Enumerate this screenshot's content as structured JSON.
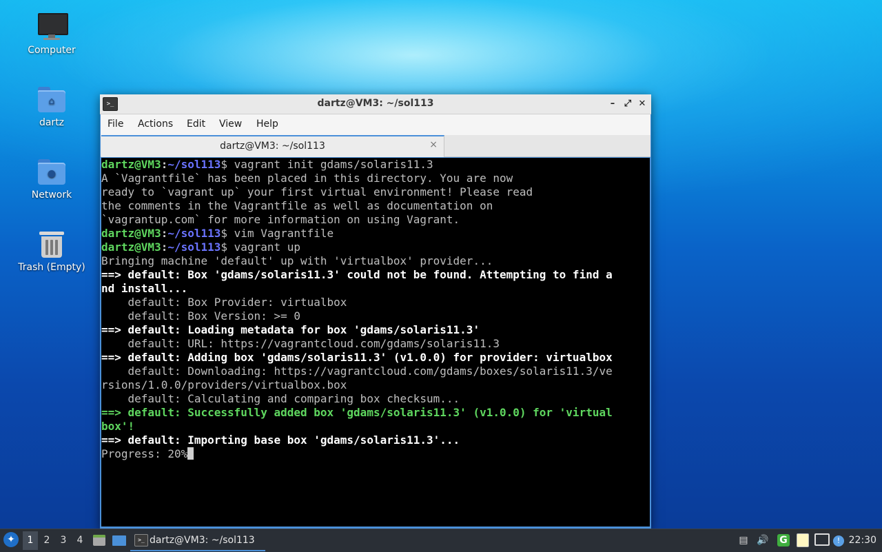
{
  "desktop": {
    "icons": [
      {
        "label": "Computer"
      },
      {
        "label": "dartz"
      },
      {
        "label": "Network"
      },
      {
        "label": "Trash (Empty)"
      }
    ]
  },
  "window": {
    "title": "dartz@VM3: ~/sol113",
    "menu": [
      "File",
      "Actions",
      "Edit",
      "View",
      "Help"
    ],
    "tab_label": "dartz@VM3: ~/sol113",
    "tab_close": "×",
    "controls": {
      "minimize": "–",
      "maximize": "⤢",
      "close": "✕"
    }
  },
  "terminal": {
    "prompt_user": "dartz@VM3",
    "prompt_path": "~/sol113",
    "commands": [
      "vagrant init gdams/solaris11.3",
      "vim Vagrantfile",
      "vagrant up"
    ],
    "output": [
      "A `Vagrantfile` has been placed in this directory. You are now",
      "ready to `vagrant up` your first virtual environment! Please read",
      "the comments in the Vagrantfile as well as documentation on",
      "`vagrantup.com` for more information on using Vagrant.",
      "Bringing machine 'default' up with 'virtualbox' provider...",
      "==> default: Box 'gdams/solaris11.3' could not be found. Attempting to find a",
      "nd install...",
      "    default: Box Provider: virtualbox",
      "    default: Box Version: >= 0",
      "==> default: Loading metadata for box 'gdams/solaris11.3'",
      "    default: URL: https://vagrantcloud.com/gdams/solaris11.3",
      "==> default: Adding box 'gdams/solaris11.3' (v1.0.0) for provider: virtualbox",
      "    default: Downloading: https://vagrantcloud.com/gdams/boxes/solaris11.3/ve",
      "rsions/1.0.0/providers/virtualbox.box",
      "    default: Calculating and comparing box checksum...",
      "==> default: Successfully added box 'gdams/solaris11.3' (v1.0.0) for 'virtual",
      "box'!",
      "==> default: Importing base box 'gdams/solaris11.3'...",
      "Progress: 20%"
    ]
  },
  "taskbar": {
    "workspaces": [
      "1",
      "2",
      "3",
      "4"
    ],
    "task_label": "dartz@VM3: ~/sol113",
    "clock": "22:30"
  }
}
